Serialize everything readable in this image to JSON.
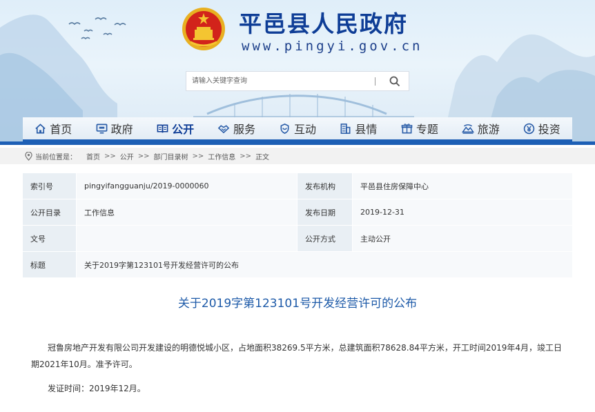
{
  "header": {
    "site_title": "平邑县人民政府",
    "site_url": "www.pingyi.gov.cn",
    "search_placeholder": "请输入关键字查询"
  },
  "nav": {
    "items": [
      {
        "label": "首页",
        "icon": "home-icon"
      },
      {
        "label": "政府",
        "icon": "monitor-icon"
      },
      {
        "label": "公开",
        "icon": "book-icon",
        "active": true
      },
      {
        "label": "服务",
        "icon": "handshake-icon"
      },
      {
        "label": "互动",
        "icon": "chat-icon"
      },
      {
        "label": "县情",
        "icon": "building-icon"
      },
      {
        "label": "专题",
        "icon": "gift-icon"
      },
      {
        "label": "旅游",
        "icon": "landscape-icon"
      },
      {
        "label": "投资",
        "icon": "yen-icon"
      }
    ]
  },
  "breadcrumb": {
    "label": "当前位置是：",
    "items": [
      "首页",
      "公开",
      "部门目录树",
      "工作信息",
      "正文"
    ],
    "separator": ">>"
  },
  "meta": {
    "rows": [
      {
        "k1": "索引号",
        "v1": "pingyifangguanju/2019-0000060",
        "k2": "发布机构",
        "v2": "平邑县住房保障中心"
      },
      {
        "k1": "公开目录",
        "v1": "工作信息",
        "k2": "发布日期",
        "v2": "2019-12-31"
      },
      {
        "k1": "文号",
        "v1": "",
        "k2": "公开方式",
        "v2": "主动公开"
      }
    ],
    "title_key": "标题",
    "title_value": "关于2019字第123101号开发经营许可的公布"
  },
  "article": {
    "title": "关于2019字第123101号开发经营许可的公布",
    "body": "冠鲁房地产开发有限公司开发建设的明德悦城小区，占地面积38269.5平方米，总建筑面积78628.84平方米，开工时间2019年4月，竣工日期2021年10月。准予许可。",
    "issue_date": "发证时间：2019年12月。"
  },
  "colors": {
    "brand_blue": "#0e3d96",
    "nav_bar": "#1d5fb5",
    "article_title": "#1d5aa8"
  }
}
